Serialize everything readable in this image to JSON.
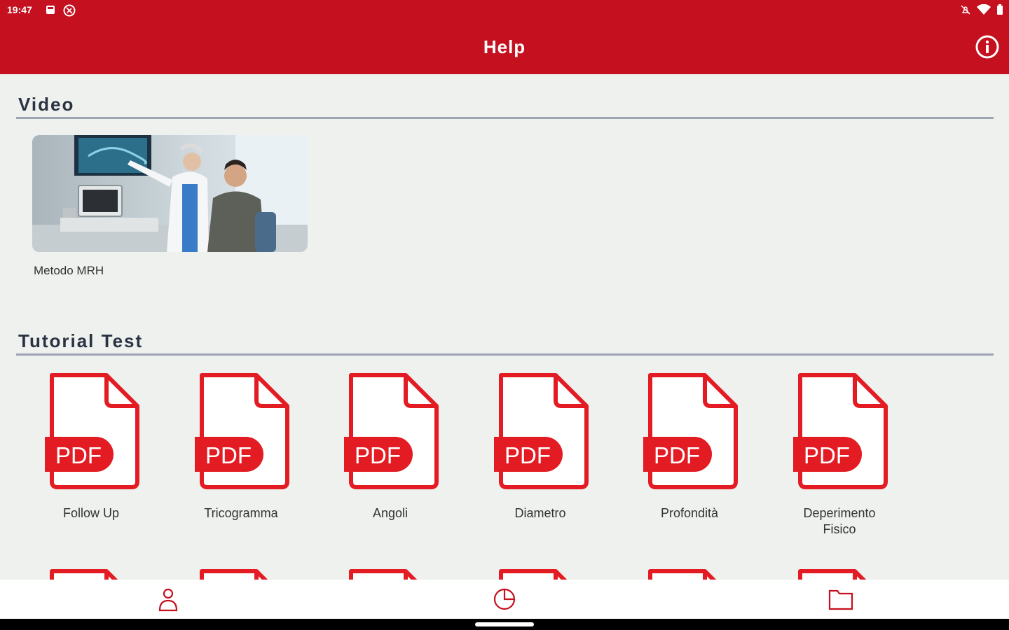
{
  "status_bar": {
    "time": "19:47"
  },
  "app_bar": {
    "title": "Help",
    "info_icon": "info-icon"
  },
  "sections": {
    "video": {
      "title": "Video",
      "items": [
        {
          "label": "Metodo MRH"
        }
      ]
    },
    "tutorial": {
      "title": "Tutorial Test",
      "items": [
        {
          "label": "Follow Up"
        },
        {
          "label": "Tricogramma"
        },
        {
          "label": "Angoli"
        },
        {
          "label": "Diametro"
        },
        {
          "label": "Profondità"
        },
        {
          "label": "Deperimento Fisico"
        }
      ]
    }
  },
  "pdf_badge": "PDF",
  "bottom_nav": [
    {
      "icon": "person-icon"
    },
    {
      "icon": "pie-chart-icon"
    },
    {
      "icon": "folder-icon"
    }
  ],
  "colors": {
    "brand_red": "#c4101f",
    "background": "#eef1ee",
    "pdf_red": "#e31b23"
  }
}
